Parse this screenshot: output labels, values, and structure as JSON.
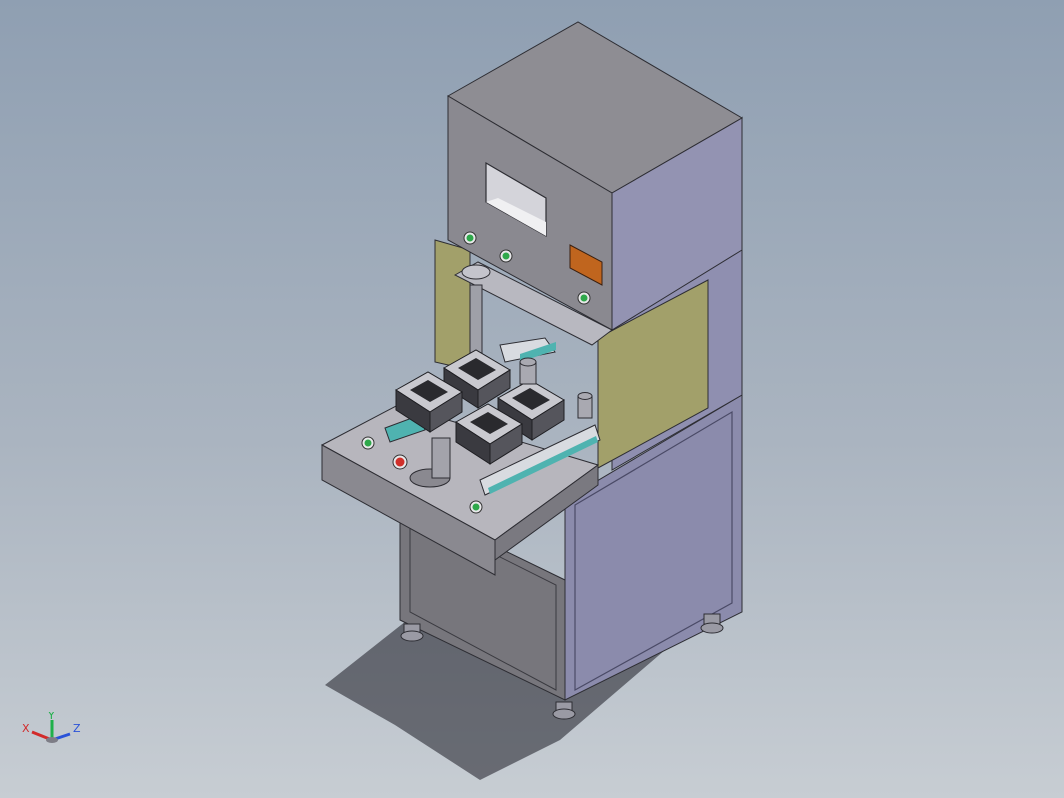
{
  "view": {
    "background_top": "#8f9fb2",
    "background_bottom": "#c7cdd3"
  },
  "machine": {
    "head_color": "#8a8990",
    "side_panel_color": "#8f8fb0",
    "guard_color": "#a2a06a",
    "base_color": "#8b8bac",
    "button_green": "#2ea84a",
    "button_red": "#d0302a",
    "nameplate_color": "#c0651e",
    "rail_color": "#4fb3b0"
  },
  "triad": {
    "x_label": "X",
    "y_label": "Y",
    "z_label": "Z",
    "x_color": "#d22a2a",
    "y_color": "#1fb04a",
    "z_color": "#2a52d8"
  }
}
